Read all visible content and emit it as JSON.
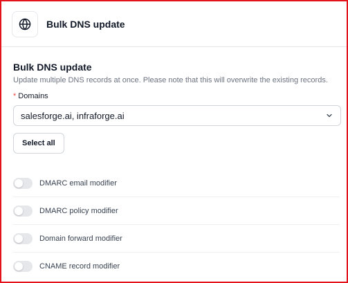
{
  "header": {
    "title": "Bulk DNS update",
    "icon": "globe-icon"
  },
  "section": {
    "title": "Bulk DNS update",
    "description": "Update multiple DNS records at once. Please note that this will overwrite the existing records."
  },
  "domains": {
    "label": "Domains",
    "required_marker": "*",
    "value": "salesforge.ai, infraforge.ai"
  },
  "select_all_label": "Select all",
  "toggles": [
    {
      "label": "DMARC email modifier",
      "on": false
    },
    {
      "label": "DMARC policy modifier",
      "on": false
    },
    {
      "label": "Domain forward modifier",
      "on": false
    },
    {
      "label": "CNAME record modifier",
      "on": false
    }
  ],
  "colors": {
    "frame_border": "#e3121b",
    "required": "#ef4444",
    "toggle_off": "#e5e7eb"
  }
}
